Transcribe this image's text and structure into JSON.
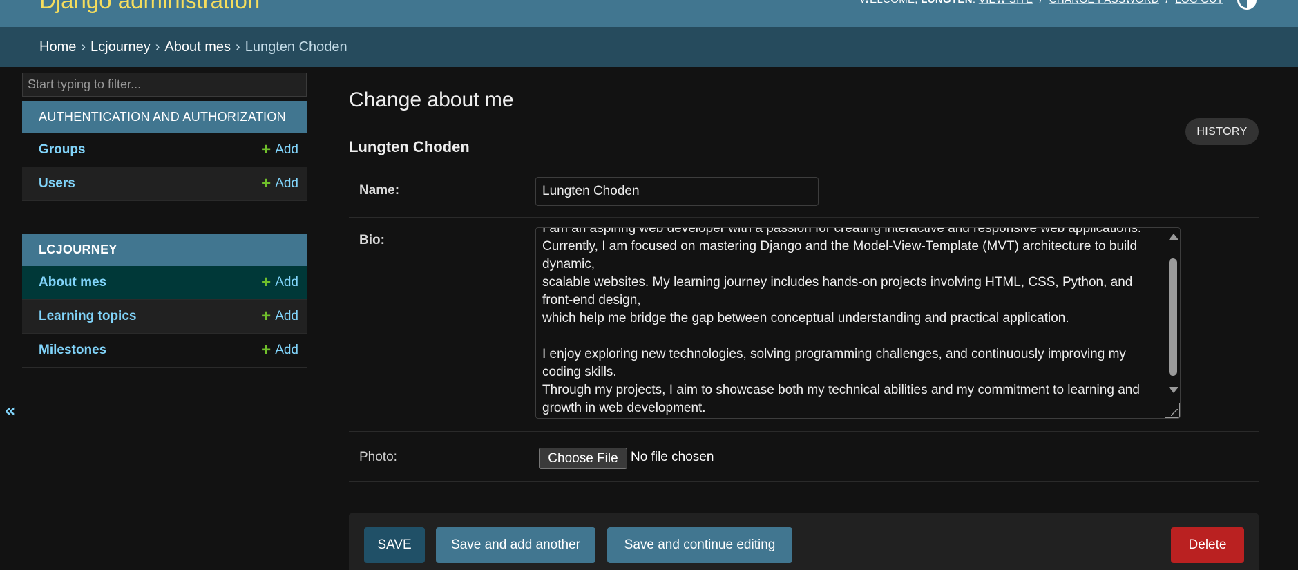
{
  "header": {
    "branding": "Django administration",
    "welcome": "WELCOME,",
    "username": "LUNGTEN",
    "view_site": "VIEW SITE",
    "change_password": "CHANGE PASSWORD",
    "log_out": "LOG OUT",
    "separator": "/"
  },
  "breadcrumbs": [
    "Home",
    "Lcjourney",
    "About mes",
    "Lungten Choden"
  ],
  "breadcrumb_separator": "›",
  "sidebar": {
    "toggle_glyph": "«",
    "filter_placeholder": "Start typing to filter...",
    "modules": [
      {
        "caption": "AUTHENTICATION AND AUTHORIZATION",
        "models": [
          {
            "name": "Groups",
            "add": "Add"
          },
          {
            "name": "Users",
            "add": "Add"
          }
        ]
      },
      {
        "caption": "LCJOURNEY",
        "models": [
          {
            "name": "About mes",
            "add": "Add",
            "current": true
          },
          {
            "name": "Learning topics",
            "add": "Add"
          },
          {
            "name": "Milestones",
            "add": "Add"
          }
        ]
      }
    ],
    "add_glyph": "+"
  },
  "main": {
    "title": "Change about me",
    "history": "HISTORY",
    "object_name": "Lungten Choden",
    "fields": {
      "name_label": "Name:",
      "name_value": "Lungten Choden",
      "bio_label": "Bio:",
      "bio_value": "I am an aspiring web developer with a passion for creating interactive and responsive web applications.\nCurrently, I am focused on mastering Django and the Model-View-Template (MVT) architecture to build dynamic,\nscalable websites. My learning journey includes hands-on projects involving HTML, CSS, Python, and front-end design,\nwhich help me bridge the gap between conceptual understanding and practical application.\n\nI enjoy exploring new technologies, solving programming challenges, and continuously improving my coding skills.\nThrough my projects, I aim to showcase both my technical abilities and my commitment to learning and growth in web development.",
      "photo_label": "Photo:",
      "choose_file": "Choose File",
      "no_file": "No file chosen"
    },
    "buttons": {
      "save": "SAVE",
      "save_add": "Save and add another",
      "save_continue": "Save and continue editing",
      "delete": "Delete"
    }
  },
  "colors": {
    "header_bg": "#417690",
    "branding": "#f5dd5d",
    "breadcrumbs_bg": "#264b5d",
    "link": "#81d4fa",
    "add_plus": "#70bf2b",
    "current_row": "#003838",
    "delete": "#ba2121",
    "page_bg": "#121212"
  }
}
